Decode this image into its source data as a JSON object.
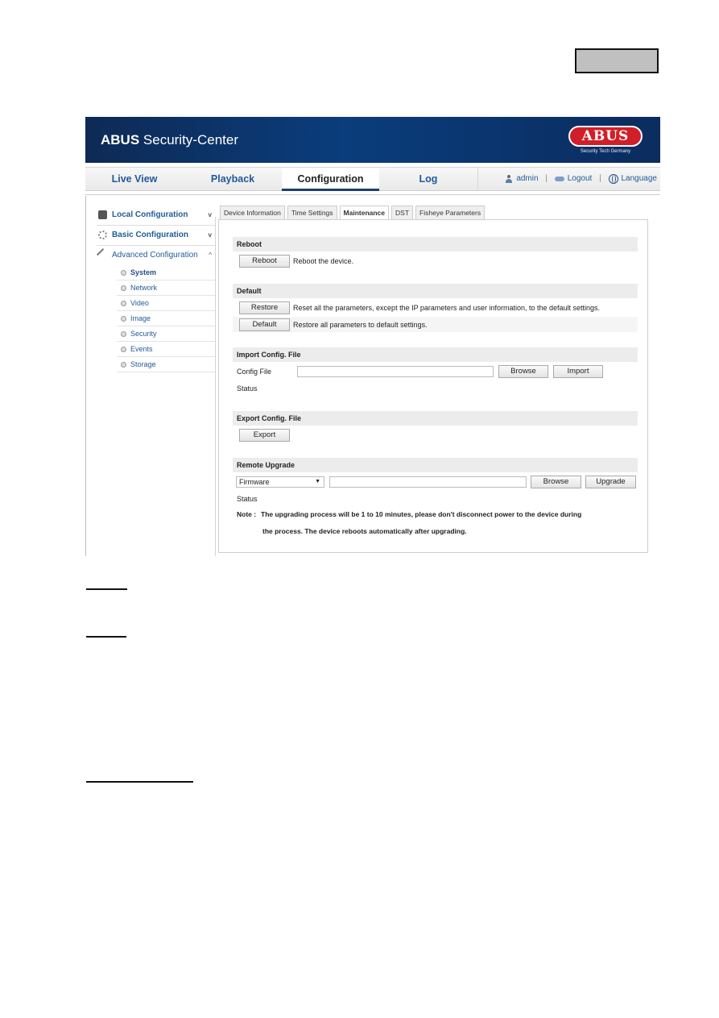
{
  "app": {
    "title_bold": "ABUS",
    "title_rest": " Security-Center",
    "logo_text": "ABUS",
    "logo_subtitle": "Security Tech Germany"
  },
  "nav": {
    "tabs": [
      {
        "label": "Live View",
        "active": false
      },
      {
        "label": "Playback",
        "active": false
      },
      {
        "label": "Configuration",
        "active": true
      },
      {
        "label": "Log",
        "active": false
      }
    ],
    "user": "admin",
    "logout": "Logout",
    "language": "Language",
    "separator": "|"
  },
  "sidebar": {
    "groups": [
      {
        "label": "Local Configuration",
        "icon": "monitor-gear-icon",
        "chevron": "v",
        "expanded": false
      },
      {
        "label": "Basic Configuration",
        "icon": "gear-icon",
        "chevron": "v",
        "expanded": false
      },
      {
        "label": "Advanced Configuration",
        "icon": "wrench-icon",
        "chevron": "^",
        "expanded": true
      }
    ],
    "items": [
      {
        "label": "System",
        "active": true
      },
      {
        "label": "Network",
        "active": false
      },
      {
        "label": "Video",
        "active": false
      },
      {
        "label": "Image",
        "active": false
      },
      {
        "label": "Security",
        "active": false
      },
      {
        "label": "Events",
        "active": false
      },
      {
        "label": "Storage",
        "active": false
      }
    ]
  },
  "subtabs": [
    {
      "label": "Device Information",
      "active": false
    },
    {
      "label": "Time Settings",
      "active": false
    },
    {
      "label": "Maintenance",
      "active": true
    },
    {
      "label": "DST",
      "active": false
    },
    {
      "label": "Fisheye Parameters",
      "active": false
    }
  ],
  "reboot": {
    "heading": "Reboot",
    "button": "Reboot",
    "description": "Reboot the device."
  },
  "default": {
    "heading": "Default",
    "restore_button": "Restore",
    "restore_description": "Reset all the parameters, except the IP parameters and user information, to the default settings.",
    "default_button": "Default",
    "default_description": "Restore all parameters to default settings."
  },
  "import": {
    "heading": "Import Config. File",
    "file_label": "Config File",
    "file_value": "",
    "browse_button": "Browse",
    "import_button": "Import",
    "status_label": "Status"
  },
  "export": {
    "heading": "Export Config. File",
    "button": "Export"
  },
  "upgrade": {
    "heading": "Remote Upgrade",
    "type_selected": "Firmware",
    "file_value": "",
    "browse_button": "Browse",
    "upgrade_button": "Upgrade",
    "status_label": "Status",
    "note_label": "Note :",
    "note_line1": "The upgrading process will be 1 to 10 minutes, please don't disconnect power to the device during",
    "note_line2": "the process. The device reboots automatically after upgrading."
  },
  "colors": {
    "banner": "#0a3d7c",
    "link_blue": "#1f5a9a",
    "logo_red": "#d11f2a",
    "section_bg": "#ececec"
  }
}
